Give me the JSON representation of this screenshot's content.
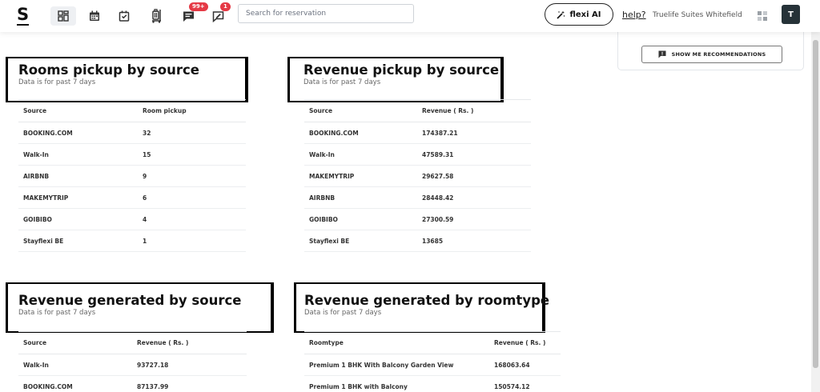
{
  "app": {
    "logo": "S"
  },
  "nav": {
    "messages_badge": "99+",
    "reviews_badge": "1"
  },
  "search": {
    "placeholder": "Search for reservation"
  },
  "header": {
    "flexi_label": "flexi AI",
    "help_label": "help?",
    "property_name": "Truelife Suites Whitefield",
    "avatar_initial": "T"
  },
  "recommendations": {
    "button_label": "SHOW ME RECOMMENDATIONS"
  },
  "sections": {
    "rooms_pickup": {
      "title": "Rooms pickup by source",
      "subtitle": "Data is for past 7 days",
      "columns": [
        "Source",
        "Room pickup"
      ],
      "rows": [
        [
          "BOOKING.COM",
          "32"
        ],
        [
          "Walk-In",
          "15"
        ],
        [
          "AIRBNB",
          "9"
        ],
        [
          "MAKEMYTRIP",
          "6"
        ],
        [
          "GOIBIBO",
          "4"
        ],
        [
          "Stayflexi BE",
          "1"
        ]
      ]
    },
    "revenue_pickup": {
      "title": "Revenue pickup by source",
      "subtitle": "Data is for past 7 days",
      "columns": [
        "Source",
        "Revenue ( Rs. )"
      ],
      "rows": [
        [
          "BOOKING.COM",
          "174387.21"
        ],
        [
          "Walk-In",
          "47589.31"
        ],
        [
          "MAKEMYTRIP",
          "29627.58"
        ],
        [
          "AIRBNB",
          "28448.42"
        ],
        [
          "GOIBIBO",
          "27300.59"
        ],
        [
          "Stayflexi BE",
          "13685"
        ]
      ]
    },
    "revenue_generated_source": {
      "title": "Revenue generated by source",
      "subtitle": "Data is for past 7 days",
      "columns": [
        "Source",
        "Revenue ( Rs. )"
      ],
      "rows": [
        [
          "Walk-In",
          "93727.18"
        ],
        [
          "BOOKING.COM",
          "87137.99"
        ]
      ]
    },
    "revenue_generated_roomtype": {
      "title": "Revenue generated by roomtype",
      "subtitle": "Data is for past 7 days",
      "columns": [
        "Roomtype",
        "Revenue ( Rs. )"
      ],
      "rows": [
        [
          "Premium 1 BHK With Balcony Garden View",
          "168063.64"
        ],
        [
          "Premium 1 BHK with Balcony",
          "150574.12"
        ]
      ]
    }
  }
}
